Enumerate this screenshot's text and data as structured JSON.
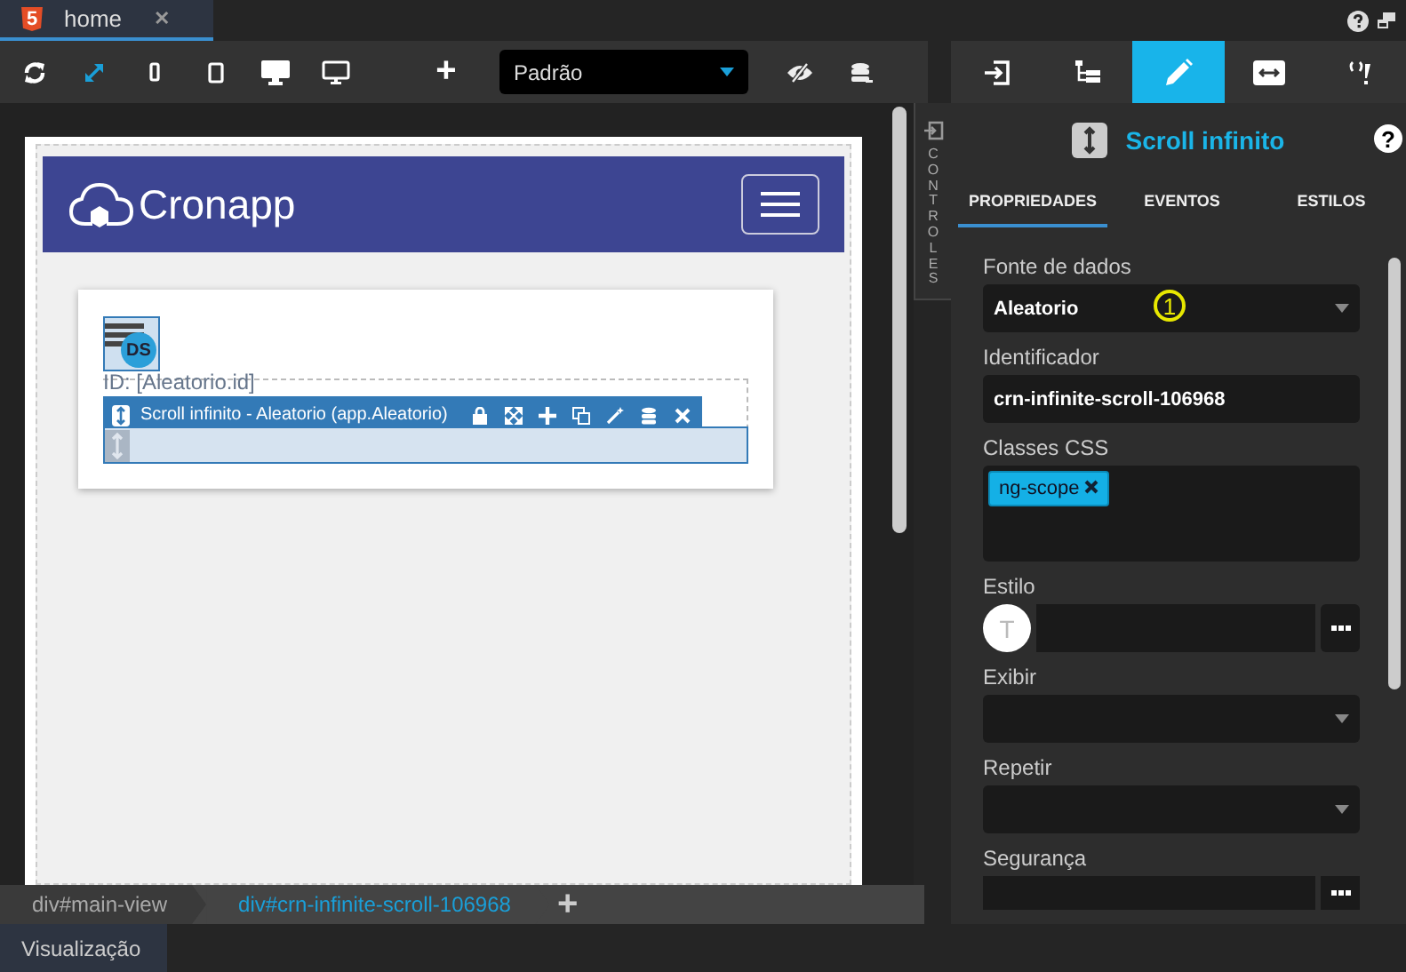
{
  "file_tab": {
    "icon": "5",
    "label": "home",
    "close": "✕"
  },
  "toolbar": {
    "devices": [
      {
        "kind": "refresh",
        "selected": false
      },
      {
        "kind": "expand",
        "selected": true
      },
      {
        "kind": "phone",
        "selected": false
      },
      {
        "kind": "tablet",
        "selected": false
      },
      {
        "kind": "desktop",
        "selected": false
      },
      {
        "kind": "monitor",
        "selected": false
      }
    ],
    "add": "+",
    "theme_select": {
      "value": "Padrão"
    }
  },
  "canvas": {
    "brand": "Cronapp",
    "datasource_badge": "DS",
    "field_text": "ID: [Aleatorio.id]",
    "component_bar": {
      "label": "Scroll infinito - Aleatorio (app.Aleatorio)",
      "actions": [
        {
          "kind": "lock"
        },
        {
          "kind": "move"
        },
        {
          "kind": "add"
        },
        {
          "kind": "copy"
        },
        {
          "kind": "wand"
        },
        {
          "kind": "database"
        },
        {
          "kind": "close"
        }
      ]
    }
  },
  "side_strip": {
    "label": "CONTROLES"
  },
  "breadcrumbs": [
    {
      "label": "div#main-view",
      "selected": false
    },
    {
      "label": "div#crn-infinite-scroll-106968",
      "selected": true
    }
  ],
  "breadcrumb_add": "+",
  "bottom_tabs": [
    {
      "label": "Visualização",
      "selected": true
    }
  ],
  "panel": {
    "tabs": [
      {
        "kind": "enter",
        "selected": false
      },
      {
        "kind": "tree",
        "selected": false
      },
      {
        "kind": "pencil",
        "selected": true
      },
      {
        "kind": "resize",
        "selected": false
      },
      {
        "kind": "brackets",
        "selected": false
      }
    ],
    "title": "Scroll infinito",
    "help": "?",
    "subtabs": [
      {
        "label": "PROPRIEDADES",
        "selected": true
      },
      {
        "label": "EVENTOS",
        "selected": false
      },
      {
        "label": "ESTILOS",
        "selected": false
      }
    ],
    "fields": [
      {
        "kind": "select",
        "label": "Fonte de dados",
        "value": "Aleatorio",
        "marker": "1"
      },
      {
        "kind": "text",
        "label": "Identificador",
        "value": "crn-infinite-scroll-106968"
      },
      {
        "kind": "tags",
        "label": "Classes CSS",
        "tags": [
          "ng-scope"
        ]
      },
      {
        "kind": "style",
        "label": "Estilo",
        "avatar": "T"
      },
      {
        "kind": "select",
        "label": "Exibir"
      },
      {
        "kind": "select",
        "label": "Repetir"
      },
      {
        "kind": "button",
        "label": "Segurança"
      }
    ]
  }
}
